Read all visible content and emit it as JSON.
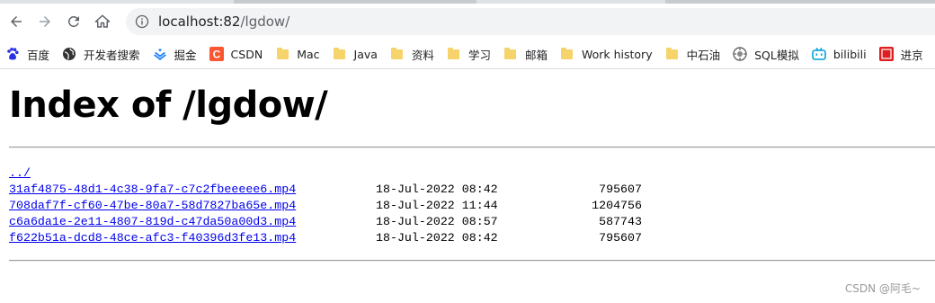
{
  "browser": {
    "url_host": "localhost:82",
    "url_path": "/lgdow/",
    "bookmarks": [
      {
        "label": "百度",
        "icon": "baidu-paw-icon"
      },
      {
        "label": "开发者搜索",
        "icon": "globe-icon"
      },
      {
        "label": "掘金",
        "icon": "juejin-icon"
      },
      {
        "label": "CSDN",
        "icon": "csdn-icon"
      },
      {
        "label": "Mac",
        "icon": "folder-icon"
      },
      {
        "label": "Java",
        "icon": "folder-icon"
      },
      {
        "label": "资料",
        "icon": "folder-icon"
      },
      {
        "label": "学习",
        "icon": "folder-icon"
      },
      {
        "label": "邮箱",
        "icon": "folder-icon"
      },
      {
        "label": "Work history",
        "icon": "folder-icon"
      },
      {
        "label": "中石油",
        "icon": "folder-icon"
      },
      {
        "label": "SQL模拟",
        "icon": "sql-icon"
      },
      {
        "label": "bilibili",
        "icon": "bilibili-icon"
      },
      {
        "label": "进京",
        "icon": "red-badge-icon"
      }
    ]
  },
  "page": {
    "title": "Index of /lgdow/",
    "parent_link": "../",
    "files": [
      {
        "name": "31af4875-48d1-4c38-9fa7-c7c2fbeeeee6.mp4",
        "date": "18-Jul-2022 08:42",
        "size": "795607"
      },
      {
        "name": "708daf7f-cf60-47be-80a7-58d7827ba65e.mp4",
        "date": "18-Jul-2022 11:44",
        "size": "1204756"
      },
      {
        "name": "c6a6da1e-2e11-4807-819d-c47da50a00d3.mp4",
        "date": "18-Jul-2022 08:57",
        "size": "587743"
      },
      {
        "name": "f622b51a-dcd8-48ce-afc3-f40396d3fe13.mp4",
        "date": "18-Jul-2022 08:42",
        "size": "795607"
      }
    ]
  },
  "watermark": "CSDN @阿毛~"
}
